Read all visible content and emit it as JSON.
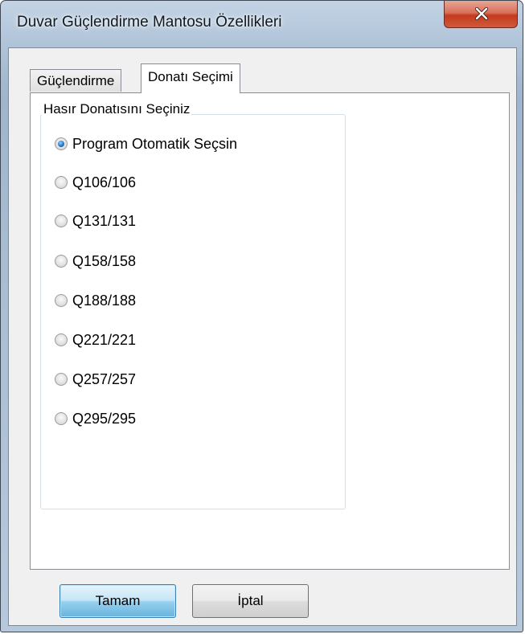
{
  "window": {
    "title": "Duvar Güçlendirme Mantosu Özellikleri",
    "close_icon": "close-icon"
  },
  "tabs": [
    {
      "label": "Güçlendirme",
      "active": false
    },
    {
      "label": "Donatı Seçimi",
      "active": true
    }
  ],
  "group": {
    "title": "Hasır Donatısını Seçiniz",
    "options": [
      {
        "label": "Program Otomatik Seçsin",
        "checked": true
      },
      {
        "label": "Q106/106",
        "checked": false
      },
      {
        "label": "Q131/131",
        "checked": false
      },
      {
        "label": "Q158/158",
        "checked": false
      },
      {
        "label": "Q188/188",
        "checked": false
      },
      {
        "label": "Q221/221",
        "checked": false
      },
      {
        "label": "Q257/257",
        "checked": false
      },
      {
        "label": "Q295/295",
        "checked": false
      }
    ]
  },
  "buttons": {
    "ok_label": "Tamam",
    "cancel_label": "İptal"
  }
}
